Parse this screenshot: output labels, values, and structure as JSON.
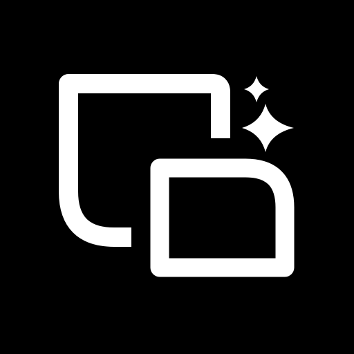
{
  "icon": {
    "name": "window-sparkle-icon",
    "background_color": "#000000",
    "foreground_color": "#FFFFFF",
    "parts": [
      "back-window-outline",
      "front-window-outline",
      "sparkle-small",
      "sparkle-large"
    ]
  }
}
